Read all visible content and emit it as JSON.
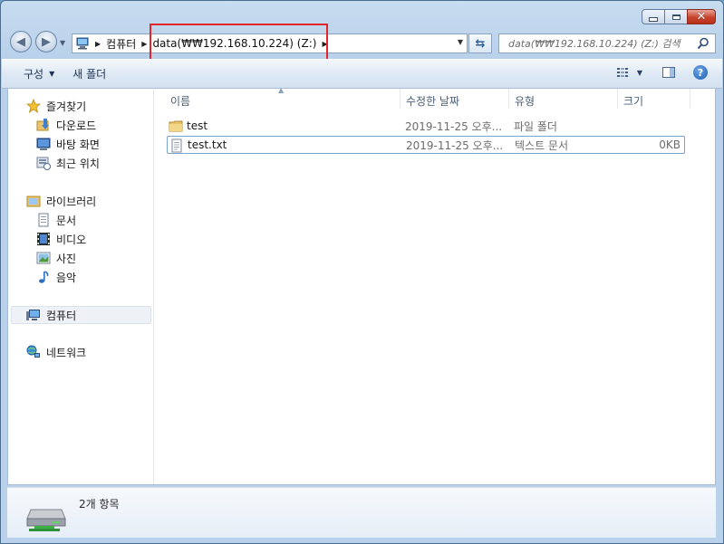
{
  "window": {
    "caption_buttons": {
      "minimize": "minimize",
      "maximize": "maximize",
      "close": "✕"
    }
  },
  "address": {
    "breadcrumbs": [
      "컴퓨터",
      "data(₩₩192.168.10.224) (Z:)"
    ]
  },
  "search": {
    "placeholder": "data(₩₩192.168.10.224) (Z:) 검색"
  },
  "toolbar": {
    "organize_label": "구성",
    "new_folder_label": "새 폴더"
  },
  "nav": {
    "favorites_label": "즐겨찾기",
    "favorites": [
      "다운로드",
      "바탕 화면",
      "최근 위치"
    ],
    "libraries_label": "라이브러리",
    "libraries": [
      "문서",
      "비디오",
      "사진",
      "음악"
    ],
    "computer_label": "컴퓨터",
    "network_label": "네트워크"
  },
  "columns": {
    "name": "이름",
    "date": "수정한 날짜",
    "type": "유형",
    "size": "크기"
  },
  "files": [
    {
      "name": "test",
      "date": "2019-11-25 오후...",
      "type": "파일 폴더",
      "size": "",
      "icon": "folder-icon"
    },
    {
      "name": "test.txt",
      "date": "2019-11-25 오후...",
      "type": "텍스트 문서",
      "size": "0KB",
      "icon": "text-file-icon"
    }
  ],
  "status": {
    "item_count": "2개 항목"
  },
  "colors": {
    "highlight": "#e3262b",
    "frame": "#b9d1ea",
    "toolbar": "#dde8f4"
  }
}
